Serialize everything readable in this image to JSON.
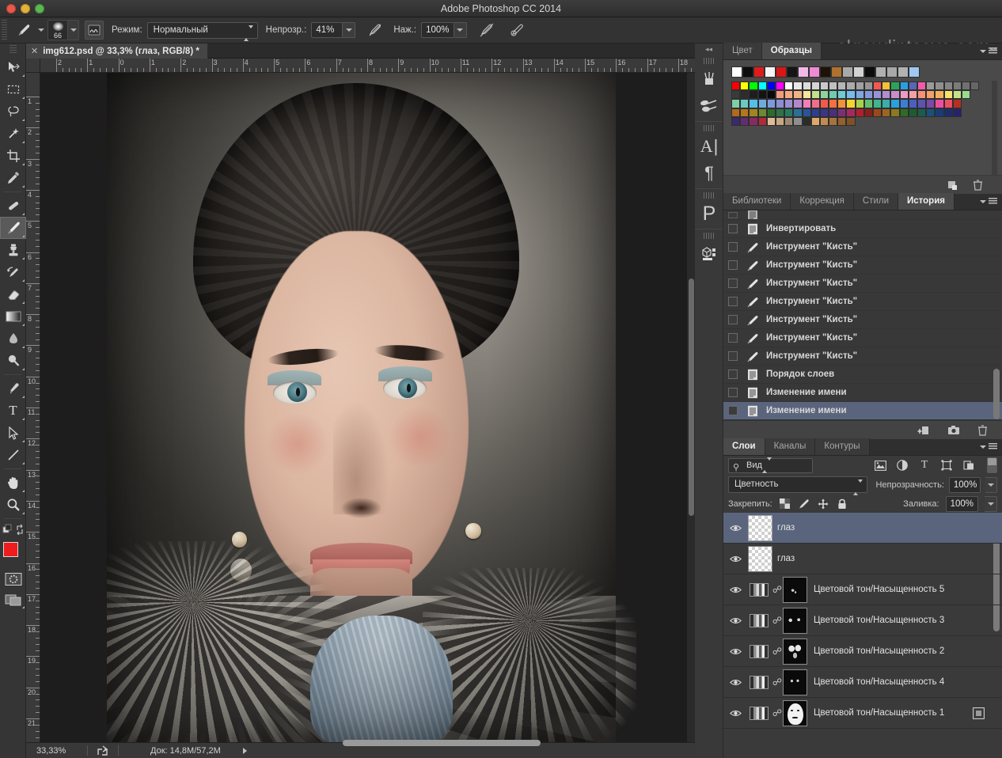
{
  "window": {
    "title": "Adobe Photoshop CC 2014",
    "watermark": "olgaudintseva.com",
    "traffic_lights": [
      "close",
      "minimize",
      "zoom"
    ]
  },
  "options_bar": {
    "tool_icon": "brush-icon",
    "brush_size": "66",
    "brush_panel_icon": "brush-panel-icon",
    "mode_label": "Режим:",
    "mode_value": "Нормальный",
    "opacity_label": "Непрозр.:",
    "opacity_value": "41%",
    "airbrush_icon": "airbrush-icon",
    "pressure_label": "Наж.:",
    "pressure_value": "100%",
    "tablet_opacity_icon": "tablet-pressure-opacity-icon",
    "tablet_size_icon": "tablet-pressure-size-icon"
  },
  "toolbar": {
    "tools": [
      {
        "name": "move-tool",
        "glyph": "move"
      },
      {
        "name": "rectangular-marquee-tool",
        "glyph": "marquee"
      },
      {
        "name": "lasso-tool",
        "glyph": "lasso"
      },
      {
        "name": "quick-selection-tool",
        "glyph": "magicwand"
      },
      {
        "name": "crop-tool",
        "glyph": "crop"
      },
      {
        "name": "eyedropper-tool",
        "glyph": "eyedropper"
      },
      {
        "name": "spot-healing-brush-tool",
        "glyph": "healing"
      },
      {
        "name": "brush-tool",
        "glyph": "brush",
        "active": true
      },
      {
        "name": "clone-stamp-tool",
        "glyph": "stamp"
      },
      {
        "name": "history-brush-tool",
        "glyph": "historybrush"
      },
      {
        "name": "eraser-tool",
        "glyph": "eraser"
      },
      {
        "name": "gradient-tool",
        "glyph": "gradient"
      },
      {
        "name": "blur-tool",
        "glyph": "blur"
      },
      {
        "name": "dodge-tool",
        "glyph": "dodge"
      },
      {
        "name": "pen-tool",
        "glyph": "pen"
      },
      {
        "name": "type-tool",
        "glyph": "T"
      },
      {
        "name": "path-selection-tool",
        "glyph": "pathselect"
      },
      {
        "name": "line-tool",
        "glyph": "line"
      },
      {
        "name": "hand-tool",
        "glyph": "hand"
      },
      {
        "name": "zoom-tool",
        "glyph": "zoom"
      }
    ],
    "foreground_color": "#ee1c1c",
    "background_color": "#f0a0c8",
    "quick_mask_icon": "quick-mask-icon",
    "screen_mode_icon": "screen-mode-icon"
  },
  "document": {
    "tab_label": "img612.psd @ 33,3% (глаз, RGB/8) *",
    "close_icon": "close-icon",
    "ruler_h_labels": [
      "2",
      "1",
      "0",
      "1",
      "2",
      "3",
      "4",
      "5",
      "6",
      "7",
      "8",
      "9",
      "10",
      "11",
      "12",
      "13",
      "14",
      "15",
      "16",
      "17",
      "18"
    ],
    "ruler_v_labels": [
      "1",
      "2",
      "3",
      "4",
      "5",
      "6",
      "7",
      "8",
      "9",
      "10",
      "11",
      "12",
      "13",
      "14",
      "15",
      "16",
      "17",
      "18",
      "19",
      "20",
      "21"
    ]
  },
  "status_bar": {
    "zoom": "33,33%",
    "share_icon": "share-icon",
    "doc_label": "Док: 14,8M/57,2M",
    "expand_icon": "play-triangle-icon"
  },
  "rail": {
    "collapse_icon": "collapse-right-icon",
    "buttons": [
      {
        "name": "brush-presets-icon",
        "glyph": "brushset"
      },
      {
        "name": "brush-panel-icon",
        "glyph": "brushpanel"
      },
      {
        "name": "character-panel-icon",
        "glyph": "A"
      },
      {
        "name": "paragraph-panel-icon",
        "glyph": "¶"
      },
      {
        "name": "properties-panel-icon",
        "glyph": "P"
      },
      {
        "name": "3d-panel-icon",
        "glyph": "3d"
      }
    ]
  },
  "swatches_panel": {
    "tabs": [
      {
        "label": "Цвет",
        "active": false
      },
      {
        "label": "Образцы",
        "active": true
      }
    ],
    "menu_icon": "panel-menu-icon",
    "new_swatch_icon": "new-swatch-icon",
    "delete_swatch_icon": "trash-icon",
    "rows": [
      [
        "#ffffff",
        "#0d0d0d",
        "#e01b1b",
        "#f5f5f5",
        "#d81616",
        "#151515",
        "#f0b9e8",
        "#ef8ad4",
        "#1c1208",
        "#b0712c",
        "#a9a9a9",
        "#d2d2d2",
        "#0c0c0c",
        "#b0b0b0",
        "#a8a8a8",
        "#b2b2b2",
        "#9fc8f2"
      ],
      [
        "#ff0000",
        "#ffff00",
        "#00ff00",
        "#00ffff",
        "#0000ff",
        "#ff00ff",
        "#ffffff",
        "#e8e8e8",
        "#dddddd",
        "#d4d4d4",
        "#cacaca",
        "#c0c0c0",
        "#b6b6b6",
        "#ababab",
        "#a0a0a0",
        "#959595",
        "#f3584f",
        "#f4c03a",
        "#2aa45a",
        "#2a9ee0",
        "#5866b4",
        "#ef5ba6",
        "#9a9a9a",
        "#8f8f8f",
        "#858585",
        "#7b7b7b",
        "#707070",
        "#666666"
      ],
      [
        "#3a3a3a",
        "#2d2d2d",
        "#1e1e1e",
        "#131313",
        "#0a0a0a",
        "#f19b7d",
        "#f4a983",
        "#f2b184",
        "#f6e79a",
        "#c3e08c",
        "#8fd39a",
        "#71cbae",
        "#6fcbd5",
        "#76bdec",
        "#7ea7e3",
        "#8896db",
        "#9a92d8",
        "#b18ed0",
        "#c78ec8",
        "#ef9ac2",
        "#f3a0a8",
        "#f49178",
        "#f3a06a",
        "#f2b25d",
        "#f5e36e",
        "#c5e08a",
        "#9ad98e"
      ],
      [
        "#7fd0a8",
        "#6cc9c0",
        "#55bde6",
        "#6fa9e0",
        "#7d9adb",
        "#8a8ed4",
        "#9a8ed0",
        "#b388cb",
        "#ef7fb8",
        "#f06f87",
        "#ef5a4e",
        "#f2713f",
        "#f3913b",
        "#f5d42f",
        "#a7d14a",
        "#63bd70",
        "#3fb58c",
        "#3aada8",
        "#2aa0dd",
        "#3d7ed4",
        "#4a5fc0",
        "#5d53b2",
        "#7a4aa6",
        "#ea4f9f",
        "#ef4e62",
        "#b7301f"
      ],
      [
        "#b06a1e",
        "#b5761f",
        "#a08520",
        "#6b8a31",
        "#2c6b2c",
        "#2e7247",
        "#2a7763",
        "#2a6f95",
        "#2a539a",
        "#2b3f8e",
        "#3b3584",
        "#4c2f7a",
        "#7d2f73",
        "#a6285f",
        "#b11f2e",
        "#8b1e18",
        "#97491b",
        "#9c6520",
        "#8a7a1f",
        "#2f6b28",
        "#1d5c33",
        "#1b5c4c",
        "#1c4f7a",
        "#1b3a78",
        "#1c2d6d",
        "#26236a"
      ],
      [
        "#3a2a6b",
        "#5f2e72",
        "#8a2a62",
        "#b02a3c",
        "#e0bb97",
        "#c8a683",
        "#9a8a72",
        "#8e8e8e",
        "#2b2b28",
        "#dfa86a",
        "#c38a52",
        "#a8723f",
        "#92612f",
        "#7d5227"
      ]
    ]
  },
  "history_panel": {
    "tabs": [
      {
        "label": "Библиотеки",
        "active": false
      },
      {
        "label": "Коррекция",
        "active": false
      },
      {
        "label": "Стили",
        "active": false
      },
      {
        "label": "История",
        "active": true
      }
    ],
    "menu_icon": "panel-menu-icon",
    "items": [
      {
        "label": "Инвертировать",
        "icon": "document-icon",
        "selected": false
      },
      {
        "label": "Инструмент \"Кисть\"",
        "icon": "brush-icon",
        "selected": false
      },
      {
        "label": "Инструмент \"Кисть\"",
        "icon": "brush-icon",
        "selected": false
      },
      {
        "label": "Инструмент \"Кисть\"",
        "icon": "brush-icon",
        "selected": false
      },
      {
        "label": "Инструмент \"Кисть\"",
        "icon": "brush-icon",
        "selected": false
      },
      {
        "label": "Инструмент \"Кисть\"",
        "icon": "brush-icon",
        "selected": false
      },
      {
        "label": "Инструмент \"Кисть\"",
        "icon": "brush-icon",
        "selected": false
      },
      {
        "label": "Инструмент \"Кисть\"",
        "icon": "brush-icon",
        "selected": false
      },
      {
        "label": "Порядок слоев",
        "icon": "document-icon",
        "selected": false
      },
      {
        "label": "Изменение имени",
        "icon": "document-icon",
        "selected": false
      },
      {
        "label": "Изменение имени",
        "icon": "document-icon",
        "selected": true
      }
    ],
    "footer_icons": [
      "new-document-from-state-icon",
      "new-snapshot-icon",
      "trash-icon"
    ]
  },
  "layers_panel": {
    "tabs": [
      {
        "label": "Слои",
        "active": true
      },
      {
        "label": "Каналы",
        "active": false
      },
      {
        "label": "Контуры",
        "active": false
      }
    ],
    "menu_icon": "panel-menu-icon",
    "filter_value": "Вид",
    "filter_icons": [
      "pixel-filter-icon",
      "adjustment-filter-icon",
      "type-filter-icon",
      "shape-filter-icon",
      "smart-object-filter-icon"
    ],
    "filter_toggle": "filter-enable-toggle",
    "blend_mode": "Цветность",
    "opacity_label": "Непрозрачность:",
    "opacity_value": "100%",
    "lock_label": "Закрепить:",
    "lock_icons": [
      "lock-transparency-icon",
      "lock-image-icon",
      "lock-position-icon",
      "lock-all-icon"
    ],
    "fill_label": "Заливка:",
    "fill_value": "100%",
    "layers": [
      {
        "name": "глаз",
        "type": "pixel",
        "visible": true,
        "selected": true
      },
      {
        "name": "глаз",
        "type": "pixel",
        "visible": true,
        "selected": false
      },
      {
        "name": "Цветовой тон/Насыщенность 5",
        "type": "adjustment",
        "visible": true,
        "selected": false
      },
      {
        "name": "Цветовой тон/Насыщенность 3",
        "type": "adjustment",
        "visible": true,
        "selected": false
      },
      {
        "name": "Цветовой тон/Насыщенность 2",
        "type": "adjustment",
        "visible": true,
        "selected": false
      },
      {
        "name": "Цветовой тон/Насыщенность 4",
        "type": "adjustment",
        "visible": true,
        "selected": false
      },
      {
        "name": "Цветовой тон/Насыщенность 1",
        "type": "adjustment",
        "visible": true,
        "selected": false,
        "has_extra_icon": true
      }
    ],
    "footer_icons": [
      "link-layers-icon",
      "layer-style-fx-icon",
      "add-mask-icon",
      "new-adjustment-layer-icon",
      "new-group-icon",
      "new-layer-icon",
      "delete-layer-icon"
    ]
  }
}
